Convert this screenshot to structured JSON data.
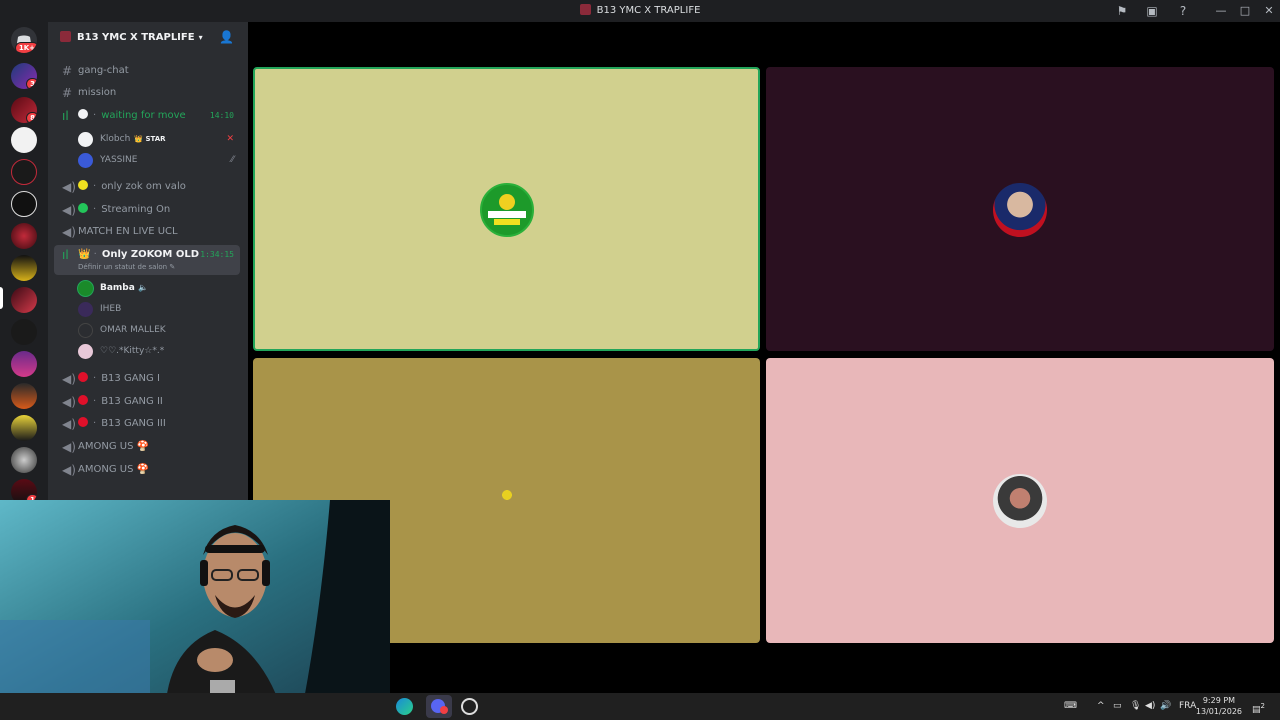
{
  "window": {
    "title": "B13 YMC X TRAPLIFE"
  },
  "server_rail": {
    "badges": [
      "1K+",
      "3",
      "8",
      "1"
    ]
  },
  "guild": {
    "name": "B13 YMC X TRAPLIFE"
  },
  "channels": {
    "gang_chat": "gang-chat",
    "mission": "mission",
    "waiting": {
      "name": "waiting for move",
      "timer": "14:10"
    },
    "waiting_members": [
      {
        "name": "Klobch",
        "tag": "STAR"
      },
      {
        "name": "YASSINE"
      }
    ],
    "zok_valo": "only zok om valo",
    "streaming": "Streaming On",
    "match": "MATCH EN LIVE UCL",
    "zokom": {
      "name": "Only ZOKOM OLD",
      "timer": "1:34:15",
      "sub": "Définir un statut de salon"
    },
    "zokom_members": [
      "Bamba",
      "IHEB",
      "OMAR MALLEK",
      "♡♡.*Kitty☆*.*"
    ],
    "gang1": "B13 GANG I",
    "gang2": "B13 GANG II",
    "gang3": "B13 GANG III",
    "among1": "AMONG US",
    "among2": "AMONG US"
  },
  "colors": {
    "tile_1": "#d1d08e",
    "tile_2": "#2a1020",
    "tile_3": "#a99449",
    "tile_4": "#e8b7b9",
    "speaking_border": "#23a55a"
  },
  "taskbar": {
    "lang": "FRA",
    "time": "9:29 PM",
    "date": "13/01/2026",
    "notif": "2"
  }
}
